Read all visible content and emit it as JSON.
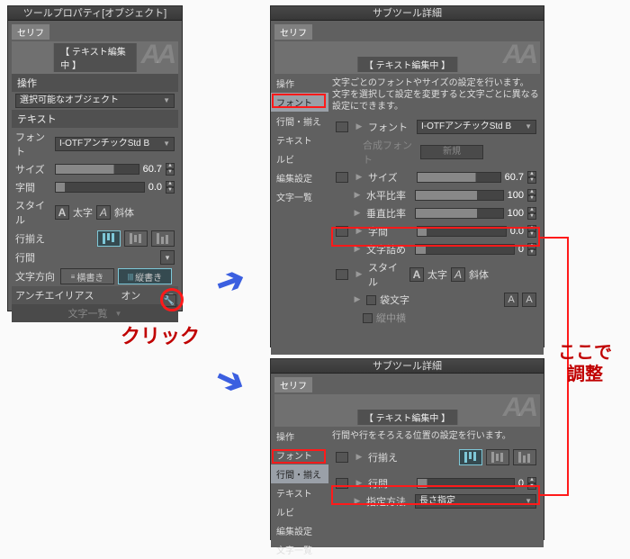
{
  "left_panel": {
    "title": "ツールプロパティ[オブジェクト]",
    "tab": "セリフ",
    "chip": "【 テキスト編集中 】",
    "section_op": "操作",
    "selectable": "選択可能なオブジェクト",
    "section_text": "テキスト",
    "font_lbl": "フォント",
    "font_val": "I-OTFアンチックStd B",
    "size_lbl": "サイズ",
    "size_val": "60.7",
    "tracking_lbl": "字間",
    "tracking_val": "0.0",
    "style_lbl": "スタイル",
    "style_bold": "太字",
    "style_italic": "斜体",
    "align_lbl": "行揃え",
    "leading_lbl": "行間",
    "dir_lbl": "文字方向",
    "dir_h": "横書き",
    "dir_v": "縦書き",
    "aa_lbl": "アンチエイリアス",
    "aa_val": "オン",
    "charlist": "文字一覧"
  },
  "detail1": {
    "title": "サブツール詳細",
    "tab": "セリフ",
    "chip": "【 テキスト編集中 】",
    "side": [
      "操作",
      "フォント",
      "行間・揃え",
      "テキスト",
      "ルビ",
      "編集設定",
      "文字一覧"
    ],
    "desc1": "文字ごとのフォントやサイズの設定を行います。",
    "desc2": "文字を選択して設定を変更すると文字ごとに異なる設定にできます。",
    "font_lbl": "フォント",
    "font_val": "I-OTFアンチックStd B",
    "compfont_lbl": "合成フォント",
    "compfont_btn": "新規",
    "size_lbl": "サイズ",
    "size_val": "60.7",
    "hratio_lbl": "水平比率",
    "hratio_val": "100",
    "vratio_lbl": "垂直比率",
    "vratio_val": "100",
    "tracking_lbl": "字間",
    "tracking_val": "0.0",
    "kerning_lbl": "文字詰め",
    "kerning_val": "0",
    "style_lbl": "スタイル",
    "style_bold": "太字",
    "style_italic": "斜体",
    "outline_lbl": "袋文字",
    "strike_lbl": "縦中横"
  },
  "detail2": {
    "title": "サブツール詳細",
    "tab": "セリフ",
    "chip": "【 テキスト編集中 】",
    "side": [
      "操作",
      "フォント",
      "行間・揃え",
      "テキスト",
      "ルビ",
      "編集設定",
      "文字一覧"
    ],
    "desc": "行間や行をそろえる位置の設定を行います。",
    "align_lbl": "行揃え",
    "leading_lbl": "行間",
    "leading_val": "0",
    "method_lbl": "指定方法",
    "method_val": "長さ指定"
  },
  "annots": {
    "click": "クリック",
    "adjust1": "ここで",
    "adjust2": "調整"
  }
}
